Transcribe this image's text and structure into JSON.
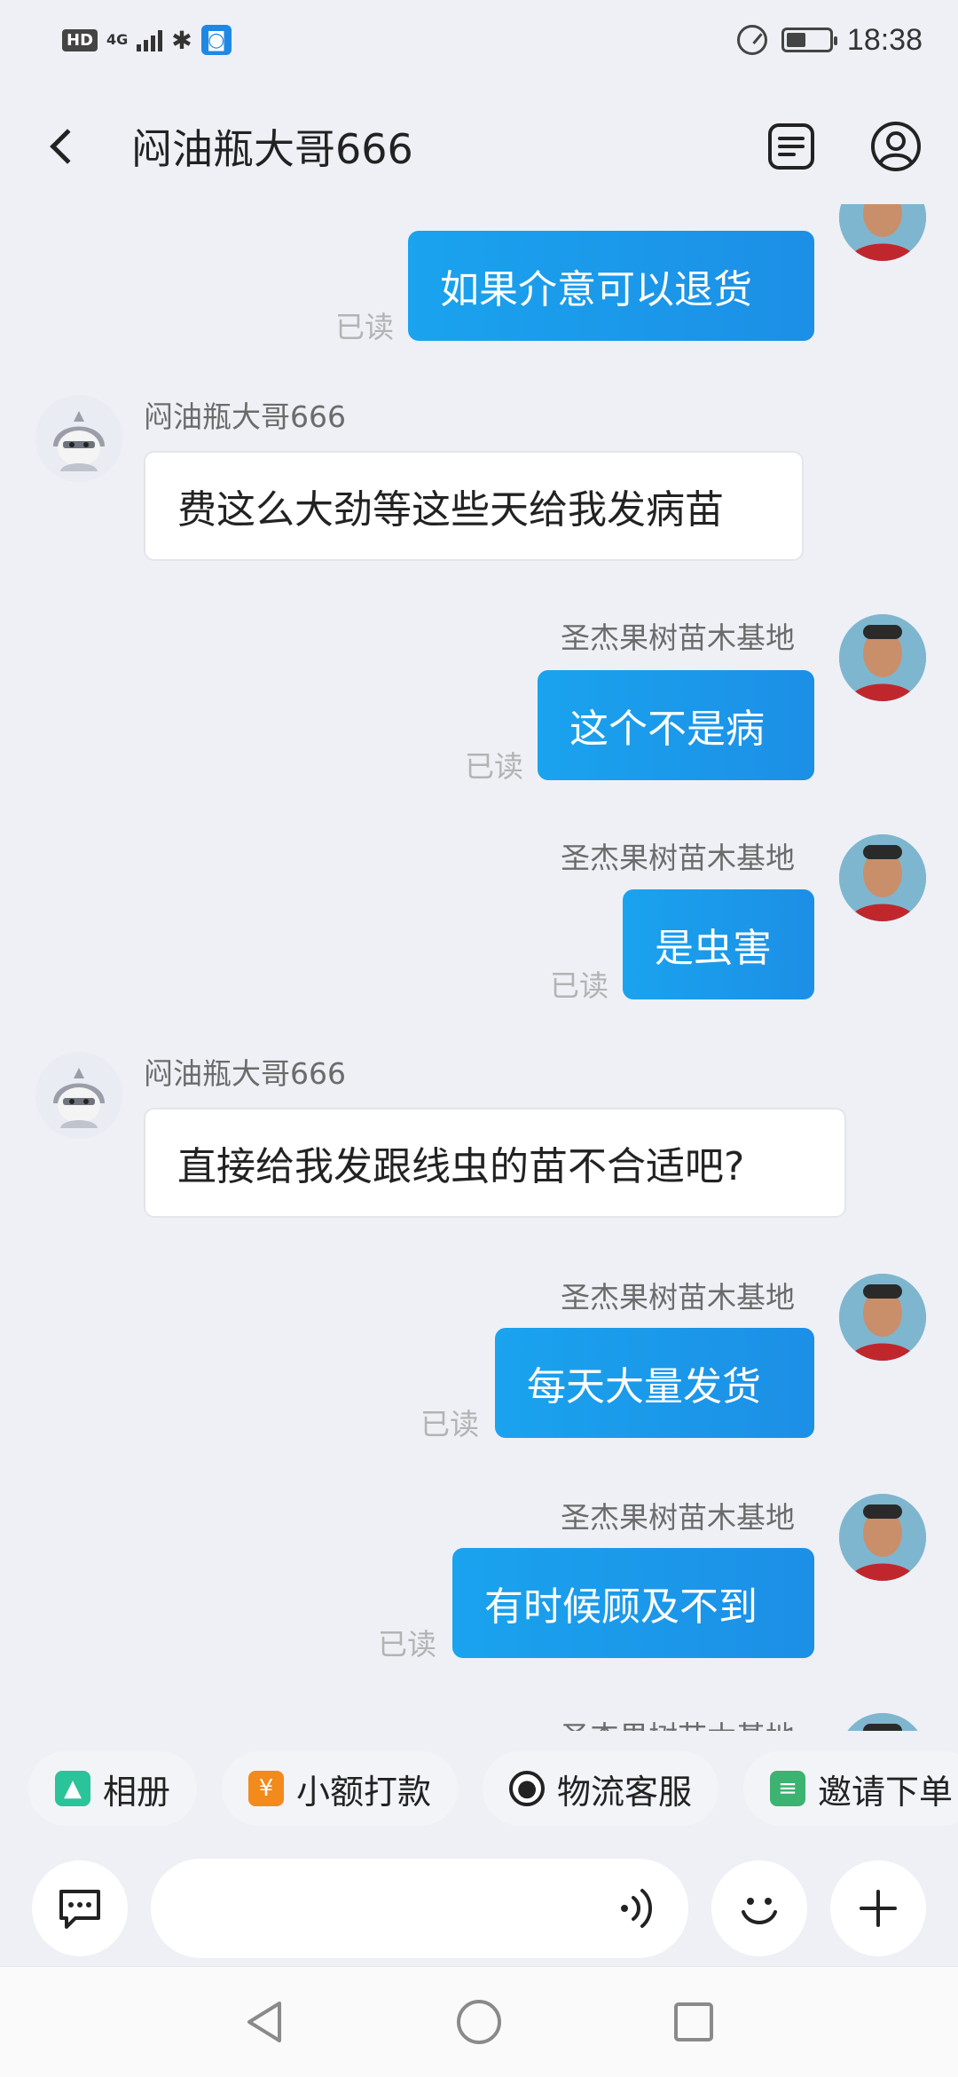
{
  "status_bar": {
    "hd": "HD",
    "network": "4G",
    "time": "18:38",
    "battery_level": 0.45
  },
  "header": {
    "title": "闷油瓶大哥666"
  },
  "messages": [
    {
      "direction": "out",
      "sender": "圣杰果树苗木基地",
      "text": "如果介意可以退货",
      "read": "已读"
    },
    {
      "direction": "in",
      "sender": "闷油瓶大哥666",
      "text": "费这么大劲等这些天给我发病苗"
    },
    {
      "direction": "out",
      "sender": "圣杰果树苗木基地",
      "text": "这个不是病",
      "read": "已读"
    },
    {
      "direction": "out",
      "sender": "圣杰果树苗木基地",
      "text": "是虫害",
      "read": "已读"
    },
    {
      "direction": "in",
      "sender": "闷油瓶大哥666",
      "text": "直接给我发跟线虫的苗不合适吧?"
    },
    {
      "direction": "out",
      "sender": "圣杰果树苗木基地",
      "text": "每天大量发货",
      "read": "已读"
    },
    {
      "direction": "out",
      "sender": "圣杰果树苗木基地",
      "text": "有时候顾及不到",
      "read": "已读"
    },
    {
      "direction": "out",
      "sender": "圣杰果树苗木基地"
    }
  ],
  "quick_actions": [
    {
      "label": "相册",
      "icon": "photo-album-icon",
      "color": "#2bc39a"
    },
    {
      "label": "小额打款",
      "icon": "payment-icon",
      "color": "#f28a1c"
    },
    {
      "label": "物流客服",
      "icon": "logistics-service-icon",
      "color": "#222222"
    },
    {
      "label": "邀请下单",
      "icon": "invite-order-icon",
      "color": "#3cb371"
    }
  ],
  "input": {
    "placeholder": ""
  }
}
